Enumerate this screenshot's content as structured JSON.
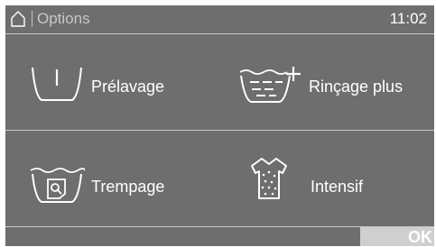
{
  "header": {
    "title": "Options",
    "time": "11:02",
    "home_icon": "home-icon"
  },
  "options": [
    {
      "label": "Prélavage",
      "icon": "prewash-basin-icon"
    },
    {
      "label": "Rinçage plus",
      "icon": "rinse-plus-icon"
    },
    {
      "label": "Trempage",
      "icon": "soak-icon"
    },
    {
      "label": "Intensif",
      "icon": "intensive-shirt-icon"
    }
  ],
  "footer": {
    "ok_label": "OK"
  },
  "colors": {
    "screen_bg": "#6e6e6e",
    "text": "#ffffff",
    "muted": "#c8c8c8",
    "ok_bg": "#cfcfcf"
  }
}
